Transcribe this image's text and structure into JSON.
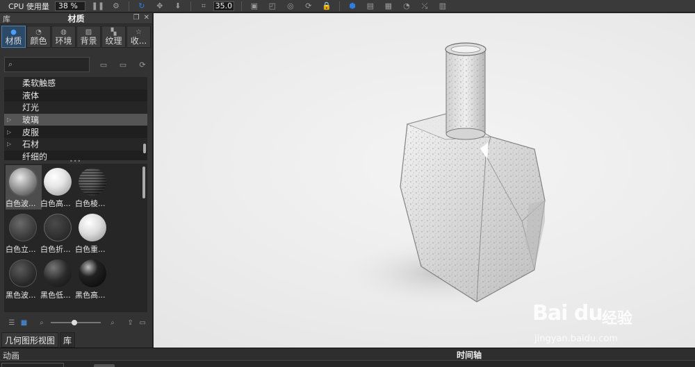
{
  "toolbar": {
    "cpu_label": "CPU 使用量",
    "cpu_value": "38 %",
    "zoom_value": "35.0"
  },
  "panel": {
    "header_left": "库",
    "title": "材质",
    "tabs": [
      {
        "label": "材质",
        "icon": "material-icon",
        "active": true
      },
      {
        "label": "颜色",
        "icon": "color-icon",
        "active": false
      },
      {
        "label": "环境",
        "icon": "environment-icon",
        "active": false
      },
      {
        "label": "背景",
        "icon": "background-icon",
        "active": false
      },
      {
        "label": "纹理",
        "icon": "texture-icon",
        "active": false
      },
      {
        "label": "收...",
        "icon": "favorites-icon",
        "active": false
      }
    ],
    "search": {
      "value": ""
    },
    "tree": [
      {
        "label": "柔软触感",
        "expandable": false
      },
      {
        "label": "液体",
        "expandable": false
      },
      {
        "label": "灯光",
        "expandable": false
      },
      {
        "label": "玻璃",
        "expandable": true,
        "selected": true
      },
      {
        "label": "皮服",
        "expandable": true
      },
      {
        "label": "石材",
        "expandable": true
      },
      {
        "label": "纤细的",
        "expandable": false
      }
    ],
    "swatches": [
      {
        "label": "白色波...",
        "style": "white-wave"
      },
      {
        "label": "白色高...",
        "style": "white-gloss"
      },
      {
        "label": "白色棱...",
        "style": "white-ridged"
      },
      {
        "label": "白色立...",
        "style": "white-textured"
      },
      {
        "label": "白色折...",
        "style": "white-refract"
      },
      {
        "label": "白色重...",
        "style": "white-heavy"
      },
      {
        "label": "黑色波...",
        "style": "black-wave"
      },
      {
        "label": "黑色低...",
        "style": "black-low"
      },
      {
        "label": "黑色高...",
        "style": "black-gloss"
      }
    ],
    "bottom_tabs": [
      {
        "label": "几何图形视图",
        "active": false
      },
      {
        "label": "库",
        "active": true
      }
    ]
  },
  "watermark": {
    "logo": "Bai du",
    "cn": "经验",
    "url": "jingyan.baidu.com"
  },
  "timeline": {
    "left_label": "动画",
    "title": "时间轴"
  }
}
